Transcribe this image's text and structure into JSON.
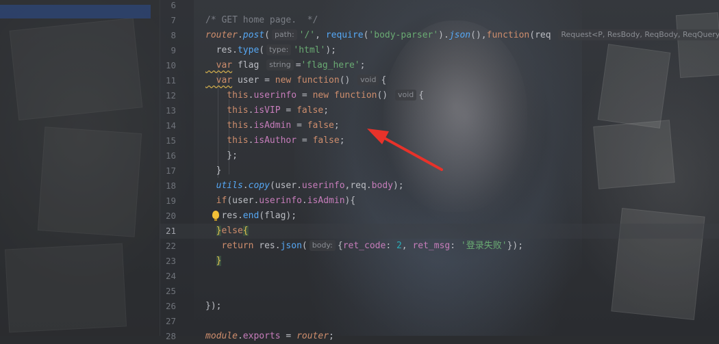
{
  "lines": [
    {
      "n": "6",
      "t": []
    },
    {
      "n": "7",
      "t": [
        {
          "c": "c-comment",
          "v": "/* GET home page.  */"
        }
      ]
    },
    {
      "n": "8",
      "t": [
        {
          "c": "c-key c-ital",
          "v": "router"
        },
        {
          "c": "c-id",
          "v": "."
        },
        {
          "c": "c-fn c-ital",
          "v": "post"
        },
        {
          "c": "c-id",
          "v": "("
        },
        {
          "h": "path:"
        },
        {
          "c": "c-str",
          "v": "'/'"
        },
        {
          "c": "c-id",
          "v": ", "
        },
        {
          "c": "c-fn",
          "v": "require"
        },
        {
          "c": "c-id",
          "v": "("
        },
        {
          "c": "c-str",
          "v": "'body-parser'"
        },
        {
          "c": "c-id",
          "v": ")."
        },
        {
          "c": "c-fn c-ital",
          "v": "json"
        },
        {
          "c": "c-id",
          "v": "(),"
        },
        {
          "c": "c-key",
          "v": "function"
        },
        {
          "c": "c-id",
          "v": "(req "
        },
        {
          "h": "Request<P, ResBody, ReqBody, ReqQuery"
        }
      ]
    },
    {
      "n": "9",
      "t": [
        {
          "c": "c-id",
          "v": "  res."
        },
        {
          "c": "c-fn",
          "v": "type"
        },
        {
          "c": "c-id",
          "v": "("
        },
        {
          "h": "type:"
        },
        {
          "c": "c-str",
          "v": "'html'"
        },
        {
          "c": "c-id",
          "v": ");"
        }
      ]
    },
    {
      "n": "10",
      "t": [
        {
          "c": "c-key c-warn",
          "v": "  var"
        },
        {
          "c": "c-id",
          "v": " flag "
        },
        {
          "h": "string"
        },
        {
          "c": "c-id",
          "v": "="
        },
        {
          "c": "c-str",
          "v": "'flag_here'"
        },
        {
          "c": "c-id",
          "v": ";"
        }
      ]
    },
    {
      "n": "11",
      "t": [
        {
          "c": "c-key c-warn",
          "v": "  var"
        },
        {
          "c": "c-id",
          "v": " user = "
        },
        {
          "c": "c-key",
          "v": "new function"
        },
        {
          "c": "c-id",
          "v": "() "
        },
        {
          "h": "void"
        },
        {
          "c": "c-id",
          "v": "{"
        }
      ]
    },
    {
      "n": "12",
      "t": [
        {
          "c": "c-key",
          "v": "    this"
        },
        {
          "c": "c-id",
          "v": "."
        },
        {
          "c": "c-prop",
          "v": "userinfo"
        },
        {
          "c": "c-id",
          "v": " = "
        },
        {
          "c": "c-key",
          "v": "new function"
        },
        {
          "c": "c-id",
          "v": "() "
        },
        {
          "h": "void"
        },
        {
          "c": "c-id",
          "v": "{"
        }
      ]
    },
    {
      "n": "13",
      "t": [
        {
          "c": "c-key",
          "v": "    this"
        },
        {
          "c": "c-id",
          "v": "."
        },
        {
          "c": "c-prop",
          "v": "isVIP"
        },
        {
          "c": "c-id",
          "v": " = "
        },
        {
          "c": "c-key",
          "v": "false"
        },
        {
          "c": "c-id",
          "v": ";"
        }
      ]
    },
    {
      "n": "14",
      "t": [
        {
          "c": "c-key",
          "v": "    this"
        },
        {
          "c": "c-id",
          "v": "."
        },
        {
          "c": "c-prop",
          "v": "isAdmin"
        },
        {
          "c": "c-id",
          "v": " = "
        },
        {
          "c": "c-key",
          "v": "false"
        },
        {
          "c": "c-id",
          "v": ";"
        }
      ]
    },
    {
      "n": "15",
      "t": [
        {
          "c": "c-key",
          "v": "    this"
        },
        {
          "c": "c-id",
          "v": "."
        },
        {
          "c": "c-prop",
          "v": "isAuthor"
        },
        {
          "c": "c-id",
          "v": " = "
        },
        {
          "c": "c-key",
          "v": "false"
        },
        {
          "c": "c-id",
          "v": ";"
        }
      ]
    },
    {
      "n": "16",
      "t": [
        {
          "c": "c-id",
          "v": "    };"
        }
      ]
    },
    {
      "n": "17",
      "t": [
        {
          "c": "c-id",
          "v": "  }"
        }
      ]
    },
    {
      "n": "18",
      "t": [
        {
          "c": "c-fn c-ital",
          "v": "  utils"
        },
        {
          "c": "c-id",
          "v": "."
        },
        {
          "c": "c-fn c-ital",
          "v": "copy"
        },
        {
          "c": "c-id",
          "v": "(user."
        },
        {
          "c": "c-prop",
          "v": "userinfo"
        },
        {
          "c": "c-id",
          "v": ",req."
        },
        {
          "c": "c-prop",
          "v": "body"
        },
        {
          "c": "c-id",
          "v": ");"
        }
      ]
    },
    {
      "n": "19",
      "t": [
        {
          "c": "c-key",
          "v": "  if"
        },
        {
          "c": "c-id",
          "v": "(user."
        },
        {
          "c": "c-prop",
          "v": "userinfo"
        },
        {
          "c": "c-id",
          "v": "."
        },
        {
          "c": "c-prop",
          "v": "isAdmin"
        },
        {
          "c": "c-id",
          "v": "){"
        }
      ]
    },
    {
      "n": "20",
      "t": [
        {
          "c": "c-id",
          "v": "   res."
        },
        {
          "c": "c-fn",
          "v": "end"
        },
        {
          "c": "c-id",
          "v": "(flag);"
        }
      ]
    },
    {
      "n": "21",
      "t": [
        {
          "c": "c-id",
          "v": "  "
        },
        {
          "c": "c-id brace-hl",
          "v": "}"
        },
        {
          "c": "c-key",
          "v": "else"
        },
        {
          "c": "c-id brace-hl",
          "v": "{"
        }
      ]
    },
    {
      "n": "22",
      "t": [
        {
          "c": "c-key",
          "v": "   return"
        },
        {
          "c": "c-id",
          "v": " res."
        },
        {
          "c": "c-fn",
          "v": "json"
        },
        {
          "c": "c-id",
          "v": "("
        },
        {
          "h": "body:"
        },
        {
          "c": "c-id",
          "v": "{"
        },
        {
          "c": "c-prop",
          "v": "ret_code"
        },
        {
          "c": "c-id",
          "v": ": "
        },
        {
          "c": "c-num",
          "v": "2"
        },
        {
          "c": "c-id",
          "v": ", "
        },
        {
          "c": "c-prop",
          "v": "ret_msg"
        },
        {
          "c": "c-id",
          "v": ": "
        },
        {
          "c": "c-str",
          "v": "'登录失败'"
        },
        {
          "c": "c-id",
          "v": "});"
        }
      ]
    },
    {
      "n": "23",
      "t": [
        {
          "c": "c-id",
          "v": "  "
        },
        {
          "c": "c-id brace-hl",
          "v": "}"
        }
      ]
    },
    {
      "n": "24",
      "t": []
    },
    {
      "n": "25",
      "t": []
    },
    {
      "n": "26",
      "t": [
        {
          "c": "c-id",
          "v": "});"
        }
      ]
    },
    {
      "n": "27",
      "t": []
    },
    {
      "n": "28",
      "t": [
        {
          "c": "c-key c-ital",
          "v": "module"
        },
        {
          "c": "c-id",
          "v": "."
        },
        {
          "c": "c-prop",
          "v": "exports"
        },
        {
          "c": "c-id",
          "v": " = "
        },
        {
          "c": "c-key c-ital",
          "v": "router"
        },
        {
          "c": "c-id",
          "v": ";"
        }
      ]
    }
  ],
  "active_line": "21",
  "icons": {
    "intention_bulb": "lightbulb-icon",
    "annotation": "red-arrow-annotation"
  },
  "colors": {
    "keyword": "#cf8e6d",
    "string": "#6aab73",
    "function": "#56a8f5",
    "property": "#c77dbb",
    "arrow": "#e8322a"
  }
}
